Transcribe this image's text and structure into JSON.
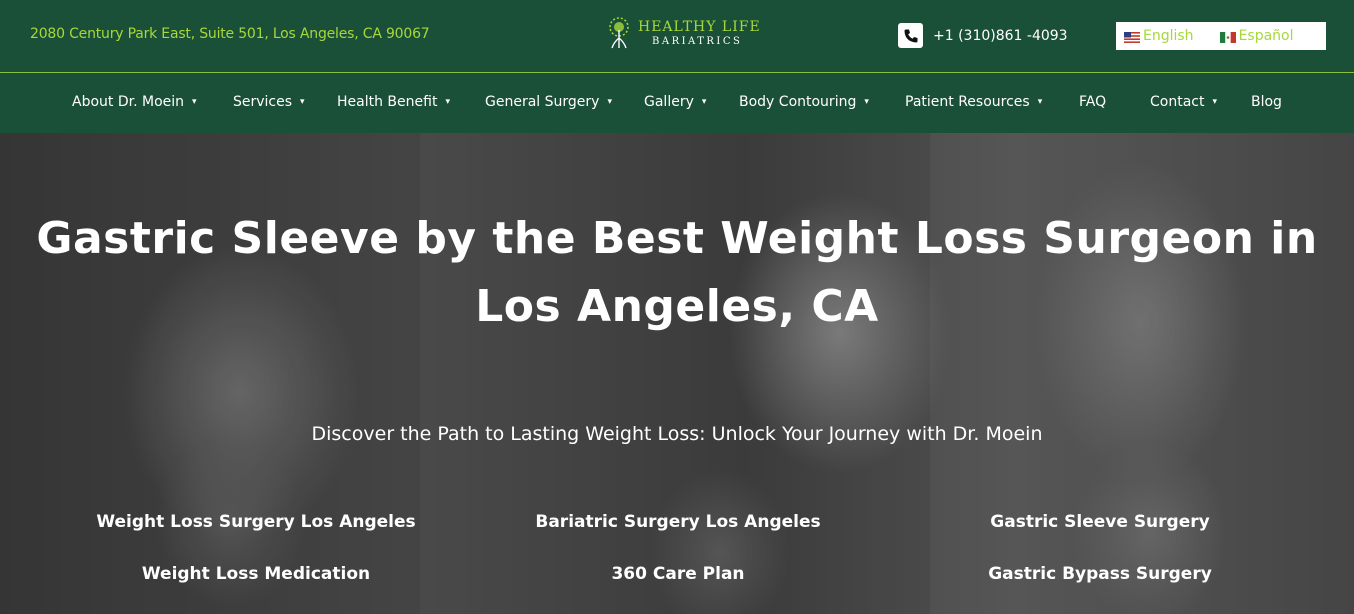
{
  "header": {
    "address": "2080 Century Park East, Suite 501, Los Angeles, CA 90067",
    "logo": {
      "line1": "HEALTHY LIFE",
      "line2": "BARIATRICS"
    },
    "phone": "+1 (310)861 -4093",
    "languages": [
      {
        "label": "English",
        "flag": "us-flag-icon"
      },
      {
        "label": "Español",
        "flag": "mx-flag-icon"
      }
    ]
  },
  "nav": {
    "items": [
      {
        "label": "About Dr. Moein",
        "dropdown": true
      },
      {
        "label": "Services",
        "dropdown": true
      },
      {
        "label": "Health Benefit",
        "dropdown": true
      },
      {
        "label": "General Surgery",
        "dropdown": true
      },
      {
        "label": "Gallery",
        "dropdown": true
      },
      {
        "label": "Body Contouring",
        "dropdown": true
      },
      {
        "label": "Patient Resources",
        "dropdown": true
      },
      {
        "label": "FAQ",
        "dropdown": false
      },
      {
        "label": "Contact",
        "dropdown": true
      },
      {
        "label": "Blog",
        "dropdown": false
      }
    ],
    "caret": "▾"
  },
  "hero": {
    "title_line1": "Gastric Sleeve by the Best Weight Loss Surgeon in",
    "title_line2": "Los Angeles, CA",
    "subtitle": "Discover the Path to Lasting Weight Loss: Unlock Your Journey with Dr. Moein",
    "links": [
      "Weight Loss Surgery Los Angeles",
      "Bariatric Surgery Los Angeles",
      "Gastric Sleeve Surgery",
      "Weight Loss Medication",
      "360 Care Plan",
      "Gastric Bypass Surgery"
    ]
  },
  "colors": {
    "header_bg": "#1b5038",
    "accent_green": "#a6d83a",
    "text_white": "#ffffff"
  }
}
